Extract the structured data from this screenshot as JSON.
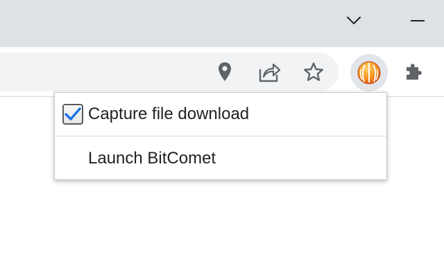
{
  "titlebar": {
    "tab_search_icon": "chevron-down-icon",
    "minimize_icon": "minimize-icon"
  },
  "toolbar": {
    "omnibox_icons": [
      "location-pin-icon",
      "share-icon",
      "star-icon"
    ],
    "extensions": [
      "bitcomet-extension-icon",
      "puzzle-extensions-icon"
    ]
  },
  "menu": {
    "items": [
      {
        "label": "Capture file download",
        "checked": true
      },
      {
        "label": "Launch BitComet"
      }
    ]
  },
  "colors": {
    "titlebar_bg": "#dee1e6",
    "omnibox_bg": "#f1f3f4",
    "icon_color": "#5f6368",
    "checkmark": "#1a73e8",
    "bitcomet_orange": "#f27a1a"
  }
}
